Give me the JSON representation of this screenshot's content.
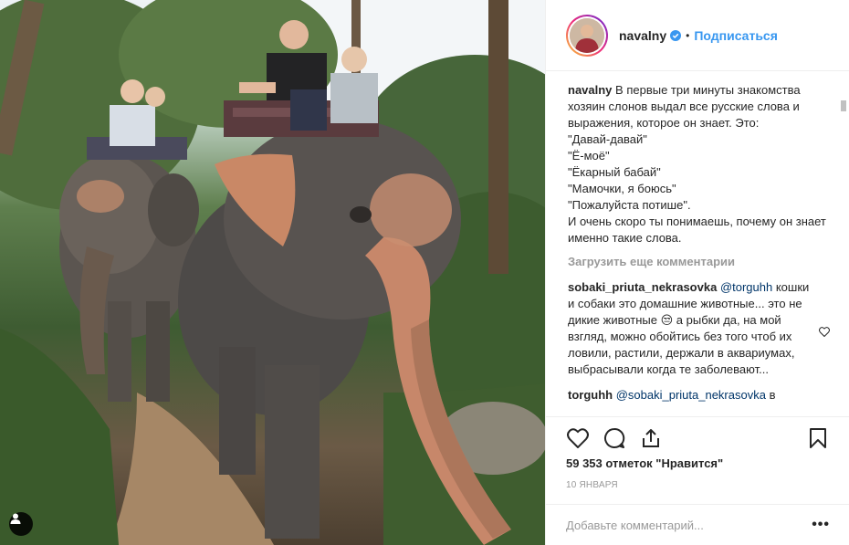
{
  "post": {
    "image_alt": "Photo: riders on two elephants in a jungle",
    "user_button_icon": "user-silhouette-icon"
  },
  "header": {
    "username": "navalny",
    "dot": "•",
    "follow_label": "Подписаться"
  },
  "caption": {
    "username": "navalny",
    "text": "В первые три минуты знакомства хозяин слонов выдал все русские слова и выражения, которое он знает. Это:\n\"Давай-давай\"\n\"Ё-моё\"\n\"Ёкарный бабай\"\n\"Мамочки, я боюсь\"\n\"Пожалуйста потише\".\nИ очень скоро ты понимаешь, почему он знает именно такие слова."
  },
  "load_more_label": "Загрузить еще комментарии",
  "comments": [
    {
      "username": "sobaki_priuta_nekrasovka",
      "mention": "@torguhh",
      "text": " кошки и собаки это домашние животные... это не дикие животные 😒 а рыбки да, на мой взгляд, можно обойтись без того чтоб их ловили, растили, держали в аквариумах, выбрасывали когда те заболевают..."
    },
    {
      "username": "torguhh",
      "mention": "@sobaki_priuta_nekrasovka",
      "text": " в"
    }
  ],
  "likes_text": "59 353 отметок \"Нравится\"",
  "date_text": "10 января",
  "add_comment": {
    "placeholder": "Добавьте комментарий...",
    "more_label": "•••"
  },
  "colors": {
    "link_blue": "#3897f0",
    "mention_blue": "#003569",
    "muted": "#999999",
    "text": "#262626",
    "border": "#efefef"
  }
}
